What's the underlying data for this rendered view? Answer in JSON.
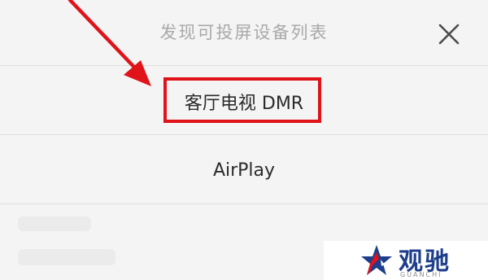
{
  "dialog": {
    "title": "发现可投屏设备列表",
    "close_icon": "close-icon"
  },
  "devices": [
    {
      "label": "客厅电视 DMR",
      "highlighted": true
    },
    {
      "label": "AirPlay",
      "highlighted": false
    }
  ],
  "annotation": {
    "arrow_color": "#e0121a",
    "box_color": "#e0121a"
  },
  "watermark": {
    "name": "观驰",
    "subtitle": "GUANCHI",
    "brand_color": "#1d3e8c",
    "accent_color": "#e0121a"
  }
}
